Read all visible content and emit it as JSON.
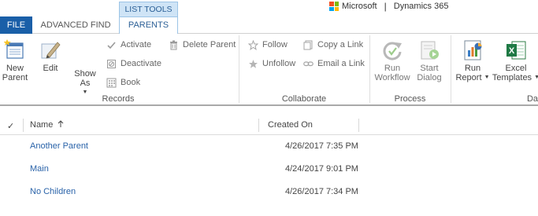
{
  "tabs": {
    "file": "FILE",
    "advanced_find": "ADVANCED FIND",
    "context_group": "LIST TOOLS",
    "parents": "PARENTS"
  },
  "brand": {
    "company": "Microsoft",
    "product": "Dynamics 365"
  },
  "ribbon": {
    "records": {
      "label": "Records",
      "new_parent": "New Parent",
      "edit": "Edit",
      "show_as": "Show As",
      "activate": "Activate",
      "deactivate": "Deactivate",
      "book": "Book",
      "delete_parent": "Delete Parent"
    },
    "collaborate": {
      "label": "Collaborate",
      "follow": "Follow",
      "unfollow": "Unfollow",
      "copy_link": "Copy a Link",
      "email_link": "Email a Link"
    },
    "process": {
      "label": "Process",
      "run_workflow": "Run Workflow",
      "start_dialog": "Start Dialog"
    },
    "data": {
      "label": "Da",
      "run_report": "Run Report",
      "excel_templates": "Excel Templates"
    }
  },
  "grid": {
    "columns": {
      "name": "Name",
      "created_on": "Created On"
    },
    "rows": [
      {
        "name": "Another Parent",
        "created_on": "4/26/2017 7:35 PM"
      },
      {
        "name": "Main",
        "created_on": "4/24/2017 9:01 PM"
      },
      {
        "name": "No Children",
        "created_on": "4/26/2017 7:34 PM"
      }
    ]
  },
  "colors": {
    "file_tab": "#1a5fa8",
    "link": "#2a63a9",
    "context_tab": "#cfe4f6",
    "ms_red": "#f25022",
    "ms_green": "#7fba00",
    "ms_blue": "#00a4ef",
    "ms_yellow": "#ffb900"
  }
}
